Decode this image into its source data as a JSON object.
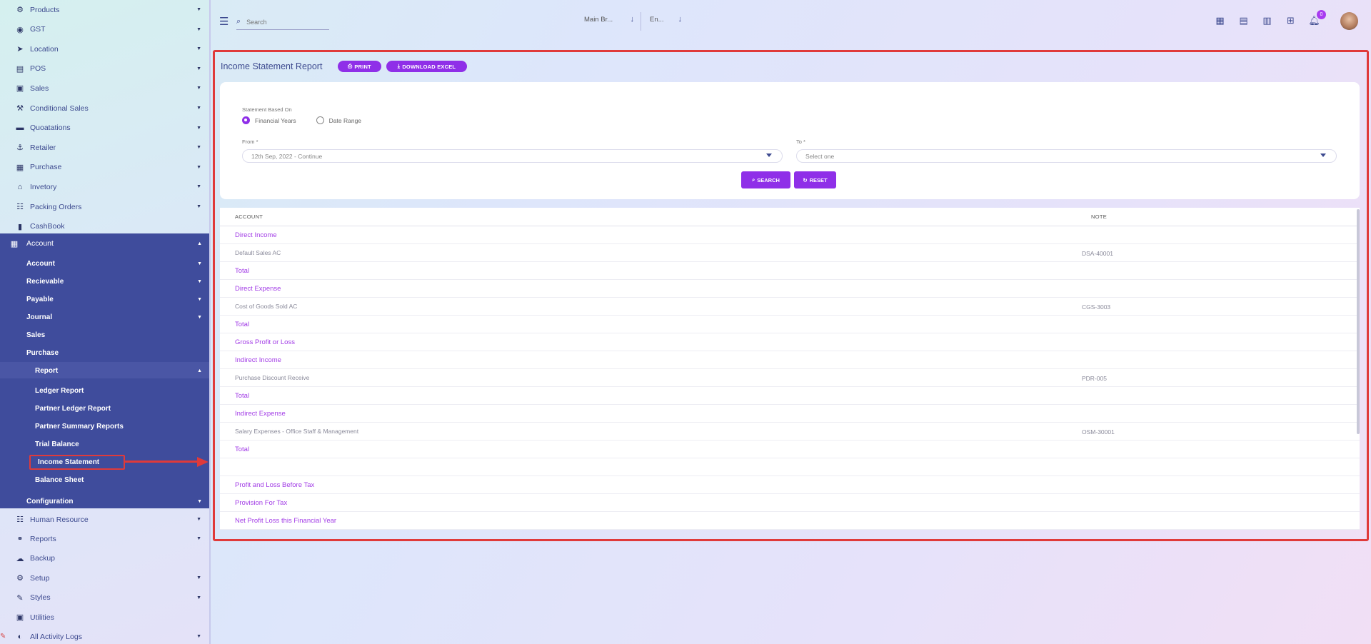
{
  "sidebar": {
    "items_top": [
      {
        "label": "Products",
        "icon": "gear-icon",
        "glyph": "⚙"
      },
      {
        "label": "GST",
        "icon": "user-badge-icon",
        "glyph": "◉"
      },
      {
        "label": "Location",
        "icon": "location-arrow-icon",
        "glyph": "➤"
      },
      {
        "label": "POS",
        "icon": "pos-terminal-icon",
        "glyph": "▤"
      },
      {
        "label": "Sales",
        "icon": "sales-box-icon",
        "glyph": "▣"
      },
      {
        "label": "Conditional Sales",
        "icon": "hammer-icon",
        "glyph": "⚒"
      },
      {
        "label": "Quoatations",
        "icon": "quotation-icon",
        "glyph": "▬"
      },
      {
        "label": "Retailer",
        "icon": "retailer-icon",
        "glyph": "⚓"
      },
      {
        "label": "Purchase",
        "icon": "cart-icon",
        "glyph": "▦"
      },
      {
        "label": "Invetory",
        "icon": "bank-icon",
        "glyph": "⌂"
      },
      {
        "label": "Packing Orders",
        "icon": "users-icon",
        "glyph": "☷"
      },
      {
        "label": "CashBook",
        "icon": "book-icon",
        "glyph": "▮"
      }
    ],
    "account": {
      "label": "Account",
      "icon": "calculator-icon",
      "glyph": "▦",
      "children": [
        {
          "label": "Account",
          "has_chevron": true
        },
        {
          "label": "Recievable",
          "has_chevron": true
        },
        {
          "label": "Payable",
          "has_chevron": true
        },
        {
          "label": "Journal",
          "has_chevron": true
        },
        {
          "label": "Sales",
          "has_chevron": false
        },
        {
          "label": "Purchase",
          "has_chevron": false
        },
        {
          "label": "Report",
          "has_chevron": true
        }
      ],
      "report_children": [
        {
          "label": "Ledger Report"
        },
        {
          "label": "Partner Ledger Report"
        },
        {
          "label": "Partner Summary Reports"
        },
        {
          "label": "Trial Balance"
        },
        {
          "label": "Income Statement"
        },
        {
          "label": "Balance Sheet"
        }
      ],
      "configuration": "Configuration"
    },
    "items_bottom": [
      {
        "label": "Human Resource",
        "icon": "users-icon",
        "glyph": "☷",
        "has_chevron": true
      },
      {
        "label": "Reports",
        "icon": "reports-network-icon",
        "glyph": "⚭",
        "has_chevron": true
      },
      {
        "label": "Backup",
        "icon": "cloud-upload-icon",
        "glyph": "☁",
        "has_chevron": false
      },
      {
        "label": "Setup",
        "icon": "cog-icon",
        "glyph": "⚙",
        "has_chevron": true
      },
      {
        "label": "Styles",
        "icon": "brush-icon",
        "glyph": "✎",
        "has_chevron": true
      },
      {
        "label": "Utilities",
        "icon": "utilities-icon",
        "glyph": "▣",
        "has_chevron": false
      },
      {
        "label": "All Activity Logs",
        "icon": "activity-log-icon",
        "glyph": "◐",
        "has_chevron": true
      }
    ]
  },
  "topbar": {
    "search_placeholder": "Search",
    "branch": "Main Br...",
    "language": "En...",
    "notification_count": "0"
  },
  "main": {
    "title": "Income Statement Report",
    "print_label": "PRINT",
    "excel_label": "DOWNLOAD EXCEL",
    "form": {
      "based_on_label": "Statement Based On",
      "radio_financial": "Financial Years",
      "radio_date": "Date Range",
      "from_label": "From *",
      "from_value": "12th Sep, 2022 - Continue",
      "to_label": "To *",
      "to_placeholder": "Select one",
      "search_label": "SEARCH",
      "reset_label": "RESET"
    },
    "table": {
      "col_account": "ACCOUNT",
      "col_note": "NOTE",
      "rows": [
        {
          "account": "Direct Income",
          "note": "",
          "kind": "head"
        },
        {
          "account": "Default Sales AC",
          "note": "DSA-40001",
          "kind": "line"
        },
        {
          "account": "Total",
          "note": "",
          "kind": "head"
        },
        {
          "account": "Direct Expense",
          "note": "",
          "kind": "head"
        },
        {
          "account": "Cost of Goods Sold AC",
          "note": "CGS-3003",
          "kind": "line"
        },
        {
          "account": "Total",
          "note": "",
          "kind": "head"
        },
        {
          "account": "Gross Profit or Loss",
          "note": "",
          "kind": "head"
        },
        {
          "account": "Indirect Income",
          "note": "",
          "kind": "head"
        },
        {
          "account": "Purchase Discount Receive",
          "note": "PDR-005",
          "kind": "line"
        },
        {
          "account": "Total",
          "note": "",
          "kind": "head"
        },
        {
          "account": "Indirect Expense",
          "note": "",
          "kind": "head"
        },
        {
          "account": "Salary Expenses - Office Staff & Management",
          "note": "OSM-30001",
          "kind": "line"
        },
        {
          "account": "Total",
          "note": "",
          "kind": "head"
        },
        {
          "account": "",
          "note": "",
          "kind": "blank"
        },
        {
          "account": "Profit and Loss Before Tax",
          "note": "",
          "kind": "head"
        },
        {
          "account": "Provision For Tax",
          "note": "",
          "kind": "head"
        },
        {
          "account": "Net Profit Loss this Financial Year",
          "note": "",
          "kind": "head"
        }
      ]
    }
  },
  "colors": {
    "accent": "#8f2fe8",
    "sidebar_active": "#3f4c9c",
    "highlight": "#e03a3a",
    "text_primary": "#3d4a8f"
  }
}
